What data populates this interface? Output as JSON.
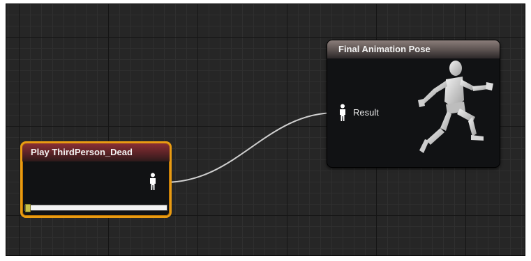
{
  "nodes": {
    "play": {
      "title": "Play ThirdPerson_Dead",
      "header_color": "#6a262a",
      "border_color": "#e99b12",
      "output_pin_icon": "figure-pin-icon",
      "progress": 0.0
    },
    "final_pose": {
      "title": "Final Animation Pose",
      "header_color": "#6e6361",
      "input_pin_label": "Result",
      "input_pin_icon": "figure-pin-icon",
      "preview_icon": "running-mannequin-icon"
    }
  },
  "connections": [
    {
      "from": "play.output",
      "to": "final_pose.result",
      "color": "#d0d0d0"
    }
  ],
  "colors": {
    "graph_background": "#262626",
    "grid_major": "#151515",
    "grid_minor": "#2f2f2f"
  }
}
